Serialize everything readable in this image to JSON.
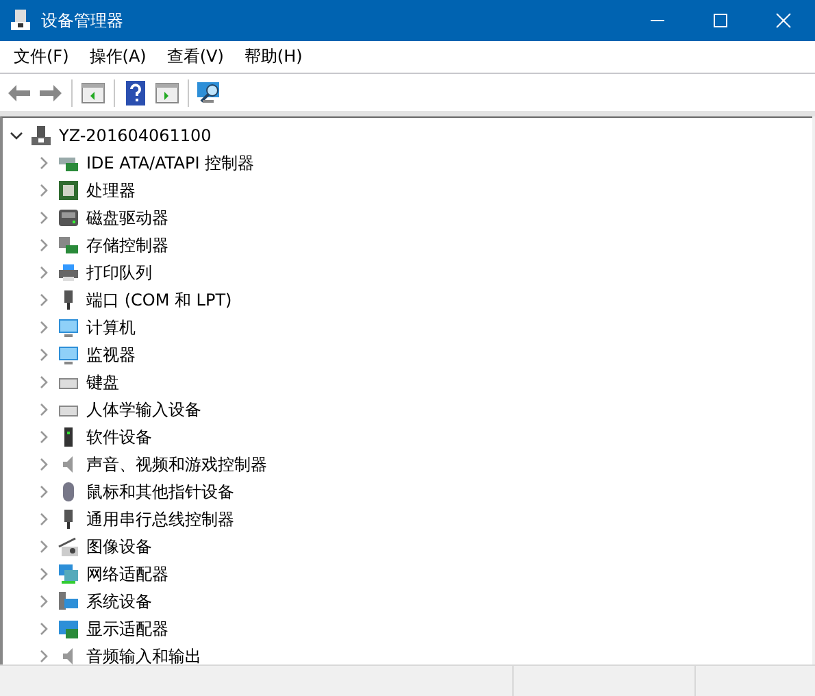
{
  "window": {
    "title": "设备管理器"
  },
  "menu": [
    "文件(F)",
    "操作(A)",
    "查看(V)",
    "帮助(H)"
  ],
  "tree": {
    "label": "YZ-201604061100",
    "expanded": true,
    "children": [
      {
        "label": "IDE ATA/ATAPI 控制器",
        "expanded": false
      },
      {
        "label": "处理器",
        "expanded": false
      },
      {
        "label": "磁盘驱动器",
        "expanded": false
      },
      {
        "label": "存储控制器",
        "expanded": false
      },
      {
        "label": "打印队列",
        "expanded": false
      },
      {
        "label": "端口 (COM 和 LPT)",
        "expanded": false
      },
      {
        "label": "计算机",
        "expanded": false
      },
      {
        "label": "监视器",
        "expanded": false
      },
      {
        "label": "键盘",
        "expanded": false
      },
      {
        "label": "人体学输入设备",
        "expanded": false
      },
      {
        "label": "软件设备",
        "expanded": false
      },
      {
        "label": "声音、视频和游戏控制器",
        "expanded": false
      },
      {
        "label": "鼠标和其他指针设备",
        "expanded": false
      },
      {
        "label": "通用串行总线控制器",
        "expanded": false
      },
      {
        "label": "图像设备",
        "expanded": false
      },
      {
        "label": "网络适配器",
        "expanded": false
      },
      {
        "label": "系统设备",
        "expanded": false
      },
      {
        "label": "显示适配器",
        "expanded": false
      },
      {
        "label": "音频输入和输出",
        "expanded": false
      }
    ]
  }
}
